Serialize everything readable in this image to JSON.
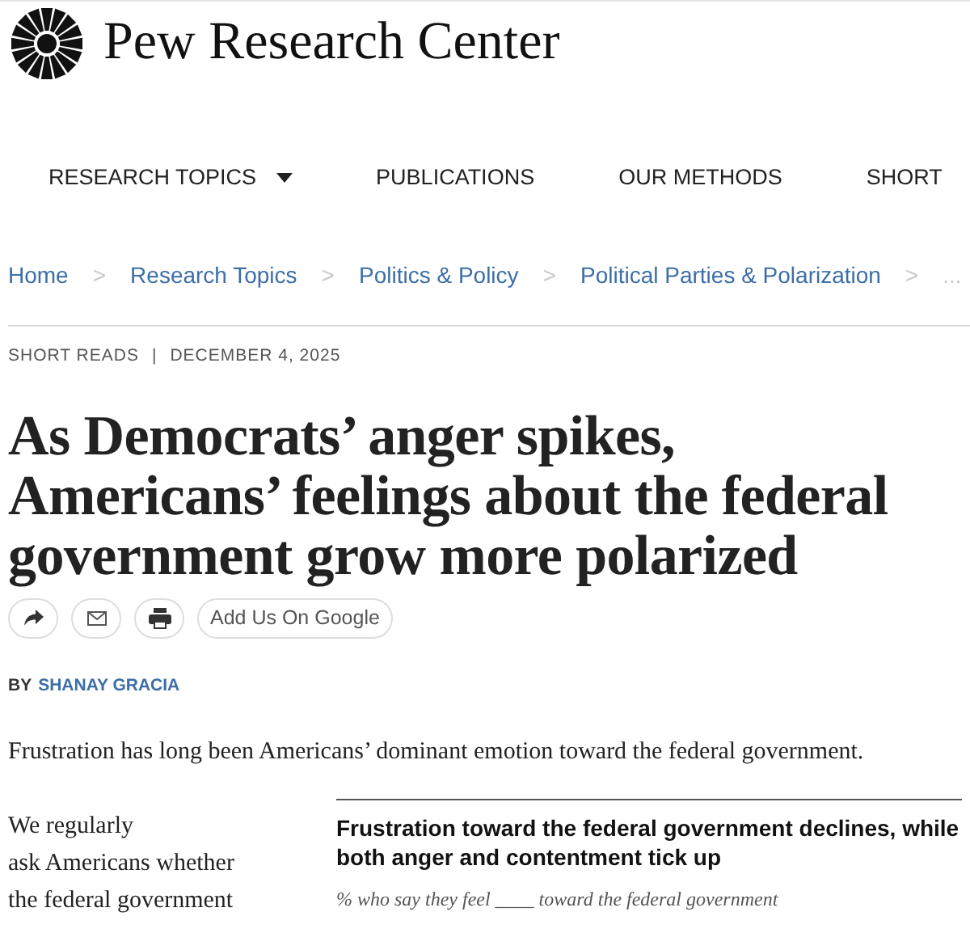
{
  "logo": {
    "text": "Pew Research Center"
  },
  "nav": [
    {
      "label": "RESEARCH TOPICS",
      "dropdown": true
    },
    {
      "label": "PUBLICATIONS",
      "dropdown": false
    },
    {
      "label": "OUR METHODS",
      "dropdown": false
    },
    {
      "label": "SHORT",
      "dropdown": false
    }
  ],
  "breadcrumbs": [
    "Home",
    "Research Topics",
    "Politics & Policy",
    "Political Parties & Polarization",
    "..."
  ],
  "breadcrumb_separators": [
    ">",
    ">",
    ">",
    ">"
  ],
  "meta": {
    "section": "SHORT READS",
    "separator": "|",
    "date": "DECEMBER 4, 2025"
  },
  "headline": "As Democrats’ anger spikes, Americans’ feelings about the federal government grow more polarized",
  "share_buttons": [
    {
      "kind": "share"
    },
    {
      "kind": "email"
    },
    {
      "kind": "print"
    },
    {
      "kind": "text",
      "label": "Add Us On Google"
    }
  ],
  "byline": {
    "prefix": "BY",
    "author": "SHANAY GRACIA"
  },
  "intro": "Frustration has long been Americans’ dominant emotion toward the federal government.",
  "body_lines": [
    "We regularly",
    "ask Americans whether",
    "the federal government"
  ],
  "chart": {
    "title": "Frustration toward the federal government declines, while both anger and contentment tick up",
    "subtitle": "% who say they feel ____ toward the federal government"
  }
}
